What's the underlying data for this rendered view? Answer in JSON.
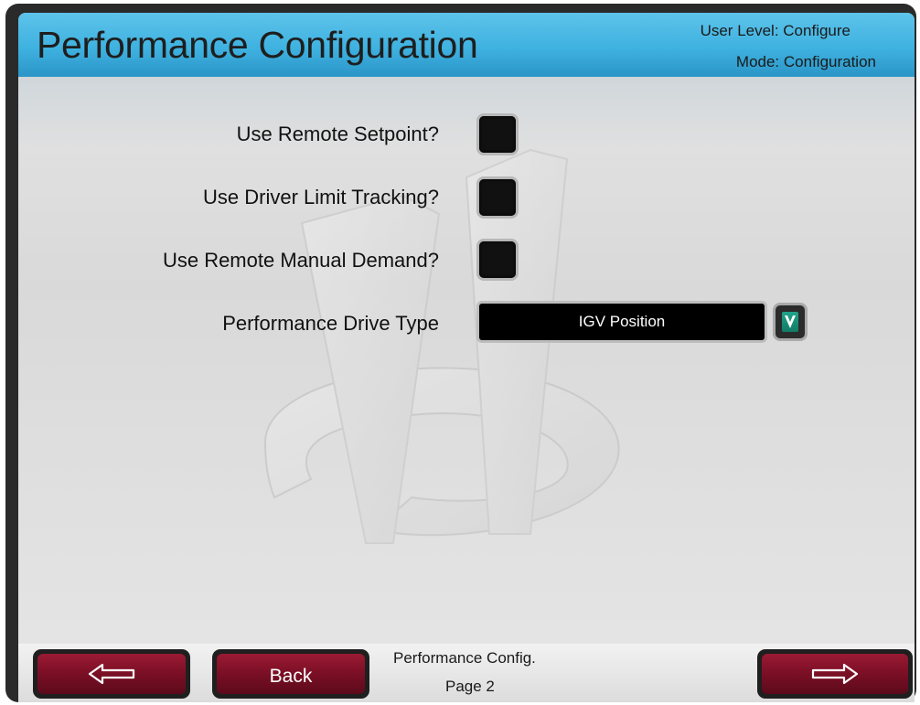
{
  "header": {
    "title": "Performance Configuration",
    "user_level": "User Level: Configure",
    "mode": "Mode: Configuration"
  },
  "options": [
    {
      "label": "Use Remote Setpoint?",
      "checked": false
    },
    {
      "label": "Use Driver Limit Tracking?",
      "checked": false
    },
    {
      "label": "Use Remote Manual Demand?",
      "checked": false
    }
  ],
  "drive_type": {
    "label": "Performance Drive Type",
    "value": "IGV Position"
  },
  "footer": {
    "back_label": "Back",
    "screen_name": "Performance Config.",
    "page": "Page 2"
  },
  "colors": {
    "header_blue": "#3fb2e0",
    "button_maroon": "#7a0f25",
    "dropdown_green": "#1fa58a"
  }
}
